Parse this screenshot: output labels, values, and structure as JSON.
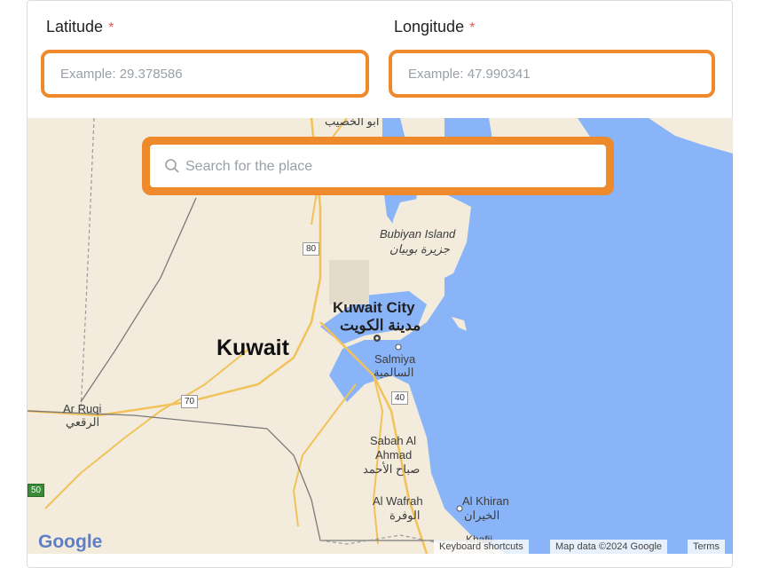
{
  "form": {
    "latitude": {
      "label": "Latitude",
      "required_mark": "*",
      "placeholder": "Example: 29.378586"
    },
    "longitude": {
      "label": "Longitude",
      "required_mark": "*",
      "placeholder": "Example: 47.990341"
    },
    "search": {
      "placeholder": "Search for the place"
    }
  },
  "map": {
    "country_label": "Kuwait",
    "labels": {
      "top_ar": "ابو الخصيب",
      "bubiyan_en": "Bubiyan Island",
      "bubiyan_ar": "جزيرة بوبيان",
      "kuwait_city_en": "Kuwait City",
      "kuwait_city_ar": "مدينة الكويت",
      "salmiya_en": "Salmiya",
      "salmiya_ar": "السالمية",
      "arruqi_en": "Ar Ruqi",
      "arruqi_ar": "الرقعي",
      "sabah_en_1": "Sabah Al",
      "sabah_en_2": "Ahmad",
      "sabah_ar": "صباح الأحمد",
      "wafrah_en": "Al Wafrah",
      "wafrah_ar": "الوفرة",
      "khiran_en": "Al Khiran",
      "khiran_ar": "الخيران",
      "khafji": "Khafji"
    },
    "shields": {
      "r80": "80",
      "r70": "70",
      "r40": "40",
      "r50": "50"
    },
    "footer": {
      "keyboard": "Keyboard shortcuts",
      "mapdata": "Map data ©2024 Google",
      "terms": "Terms"
    },
    "logo": "Google"
  },
  "colors": {
    "accent": "#ee8a2c",
    "water": "#8ab4f8",
    "land": "#f3ecdd",
    "required": "#e05a5a"
  }
}
